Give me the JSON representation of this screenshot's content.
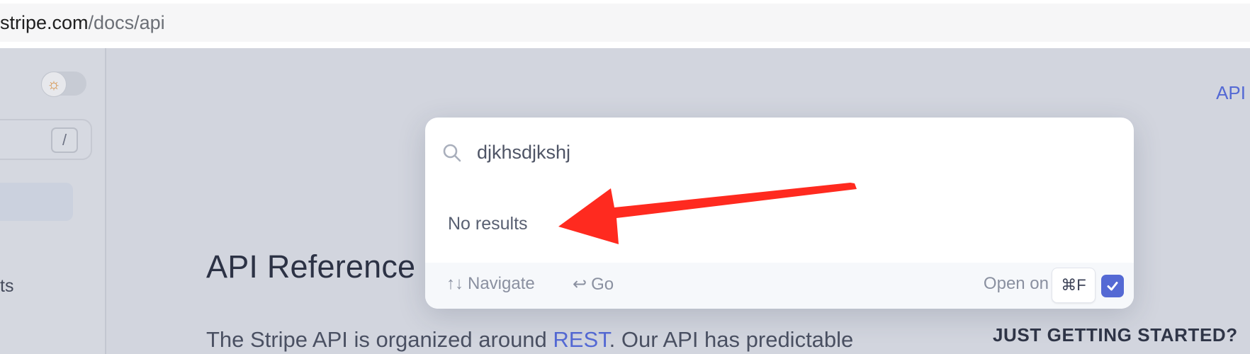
{
  "browser": {
    "url_host": "stripe.com",
    "url_path": "/docs/api"
  },
  "sidebar": {
    "search_shortcut": "/",
    "item_fragment": "ts"
  },
  "header": {
    "top_link": "API"
  },
  "main": {
    "title": "API Reference",
    "intro_before_link": "The Stripe API is organized around ",
    "intro_link": "REST",
    "intro_after_link": ". Our API has predictable"
  },
  "aside": {
    "heading": "JUST GETTING STARTED?"
  },
  "search_modal": {
    "query": "djkhsdjkshj",
    "empty_message": "No results",
    "footer": {
      "navigate_glyph": "↑↓",
      "navigate_label": "Navigate",
      "go_glyph": "↩",
      "go_label": "Go",
      "open_on_label": "Open on",
      "open_on_shortcut": "⌘F",
      "open_on_checked": true
    }
  },
  "colors": {
    "accent": "#5469d4",
    "annotation_arrow": "#ff2a1f"
  },
  "icons": {
    "search": "search-icon",
    "theme": "sun-icon",
    "checkbox": "check-icon"
  }
}
